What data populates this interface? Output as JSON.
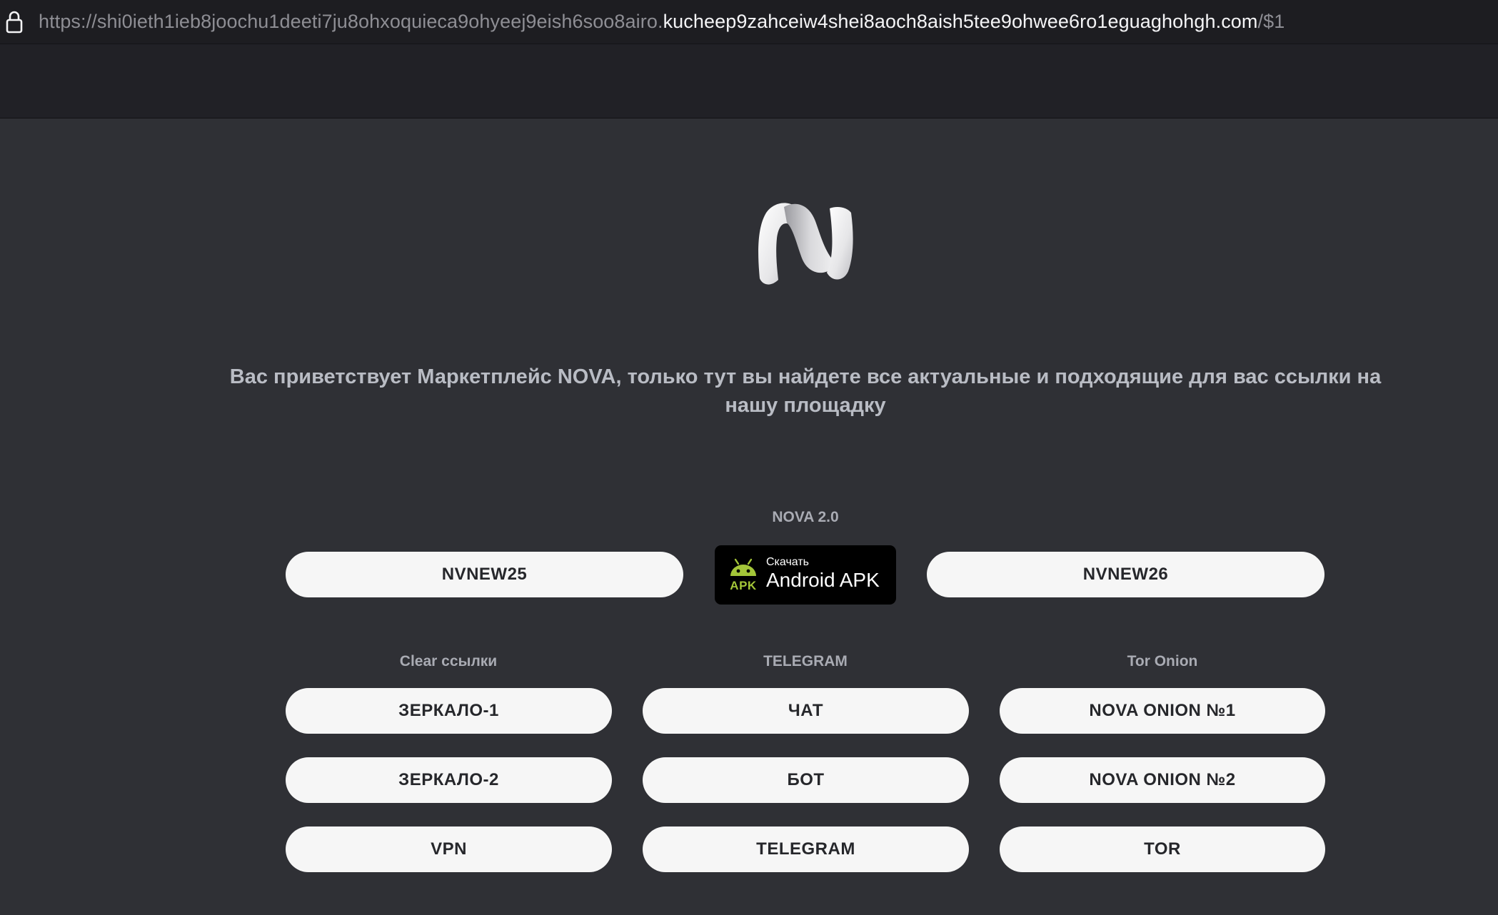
{
  "browser": {
    "url_prefix": "https://shi0ieth1ieb8joochu1deeti7ju8ohxoquieca9ohyeej9eish6soo8airo.",
    "url_domain": "kucheep9zahceiw4shei8aoch8aish5tee9ohwee6ro1eguaghohgh.com",
    "url_suffix": "/$1",
    "lock_icon": "lock-icon"
  },
  "logo_icon": "nova-logo-icon",
  "welcome_text": "Вас приветствует Маркетплейс NOVA, только тут вы найдете все актуальные и подходящие для вас ссылки на нашу площадку",
  "nova2": {
    "label": "NOVA 2.0",
    "left_button": "NVNEW25",
    "right_button": "NVNEW26",
    "apk": {
      "small": "Скачать",
      "big": "Android APK",
      "tag": "APK",
      "icon": "android-icon"
    }
  },
  "columns": [
    {
      "label": "Clear ссылки",
      "buttons": [
        "ЗЕРКАЛО-1",
        "ЗЕРКАЛО-2",
        "VPN"
      ]
    },
    {
      "label": "TELEGRAM",
      "buttons": [
        "ЧАТ",
        "БОТ",
        "TELEGRAM"
      ]
    },
    {
      "label": "Tor Onion",
      "buttons": [
        "NOVA ONION №1",
        "NOVA ONION №2",
        "TOR"
      ]
    }
  ],
  "colors": {
    "background": "#2f3035",
    "header": "#212126",
    "button": "#f6f6f6",
    "android_green": "#a4c639"
  }
}
